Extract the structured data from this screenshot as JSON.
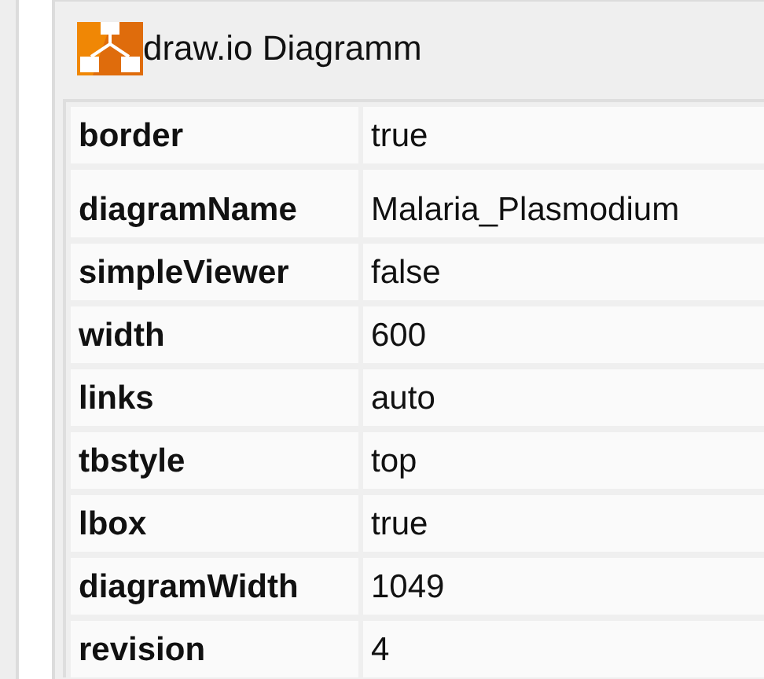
{
  "panel": {
    "title": "draw.io Diagramm"
  },
  "properties": [
    {
      "name": "border",
      "value": "true"
    },
    {
      "name": "diagramName",
      "value": "Malaria_Plasmodium"
    },
    {
      "name": "simpleViewer",
      "value": "false"
    },
    {
      "name": "width",
      "value": "600"
    },
    {
      "name": "links",
      "value": "auto"
    },
    {
      "name": "tbstyle",
      "value": "top"
    },
    {
      "name": "lbox",
      "value": "true"
    },
    {
      "name": "diagramWidth",
      "value": "1049"
    },
    {
      "name": "revision",
      "value": "4"
    }
  ]
}
